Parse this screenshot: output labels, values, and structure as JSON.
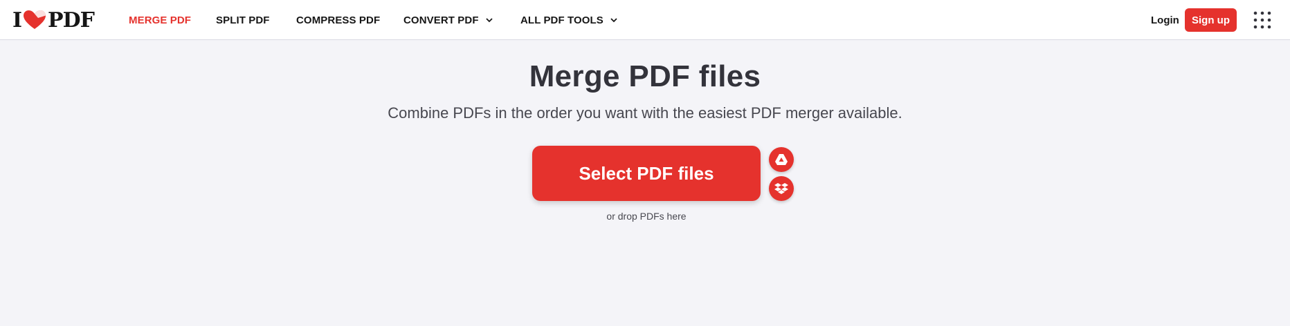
{
  "header": {
    "logo": {
      "left": "I",
      "right": "PDF"
    },
    "nav": [
      {
        "label": "MERGE PDF",
        "active": true
      },
      {
        "label": "SPLIT PDF"
      },
      {
        "label": "COMPRESS PDF"
      },
      {
        "label": "CONVERT PDF",
        "dropdown": true
      },
      {
        "label": "ALL PDF TOOLS",
        "dropdown": true
      }
    ],
    "login_label": "Login",
    "signup_label": "Sign up"
  },
  "main": {
    "title": "Merge PDF files",
    "subtitle": "Combine PDFs in the order you want with the easiest PDF merger available.",
    "select_button_label": "Select PDF files",
    "drop_hint": "or drop PDFs here",
    "cloud_sources": [
      {
        "icon": "google-drive-icon"
      },
      {
        "icon": "dropbox-icon"
      }
    ]
  },
  "colors": {
    "accent": "#e5322d",
    "background": "#f4f4f8",
    "header_bg": "#ffffff",
    "text_dark": "#33333b"
  }
}
